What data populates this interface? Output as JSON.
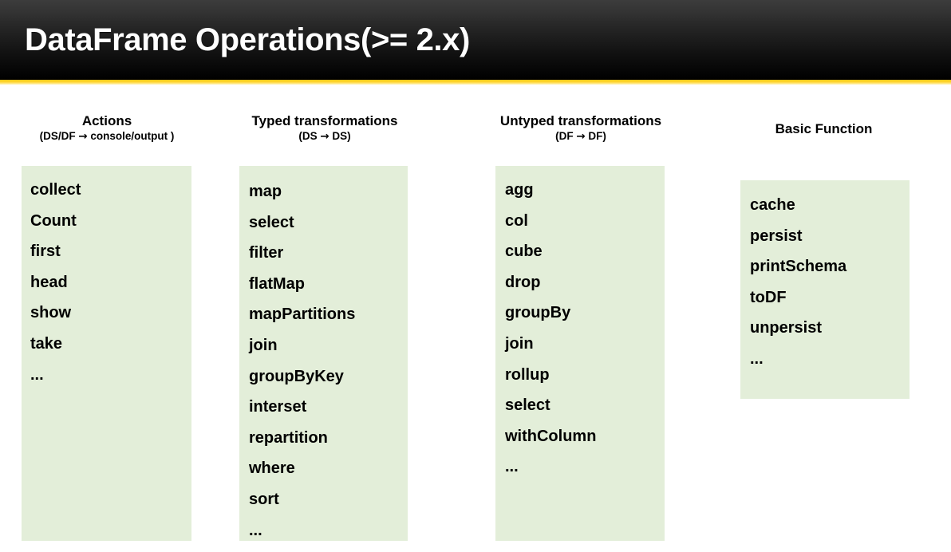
{
  "slide": {
    "title": "DataFrame Operations(>= 2.x)",
    "accent_color": "#f5c518",
    "header_background": "#000000",
    "box_background": "#e3eed9",
    "text_color": "#000000"
  },
  "columns": [
    {
      "id": "actions",
      "title": "Actions",
      "subtitle_left": "(DS/DF",
      "subtitle_arrow": "→",
      "subtitle_right": "console/output )",
      "items": [
        "collect",
        "Count",
        "first",
        "head",
        "show",
        "take",
        "..."
      ]
    },
    {
      "id": "typed",
      "title": "Typed transformations",
      "subtitle_left": "(DS",
      "subtitle_arrow": "→",
      "subtitle_right": "DS)",
      "items": [
        "map",
        "select",
        "filter",
        "flatMap",
        "mapPartitions",
        "join",
        "groupByKey",
        "interset",
        "repartition",
        "where",
        "sort",
        "..."
      ]
    },
    {
      "id": "untyped",
      "title": "Untyped transformations",
      "subtitle_left": "(DF",
      "subtitle_arrow": "→",
      "subtitle_right": "DF)",
      "items": [
        "agg",
        "col",
        "cube",
        "drop",
        "groupBy",
        "join",
        "rollup",
        "select",
        "withColumn",
        "..."
      ]
    },
    {
      "id": "basic",
      "title": "Basic Function",
      "subtitle_left": "",
      "subtitle_arrow": "",
      "subtitle_right": "",
      "items": [
        "cache",
        "persist",
        "printSchema",
        "toDF",
        "unpersist",
        "..."
      ]
    }
  ]
}
